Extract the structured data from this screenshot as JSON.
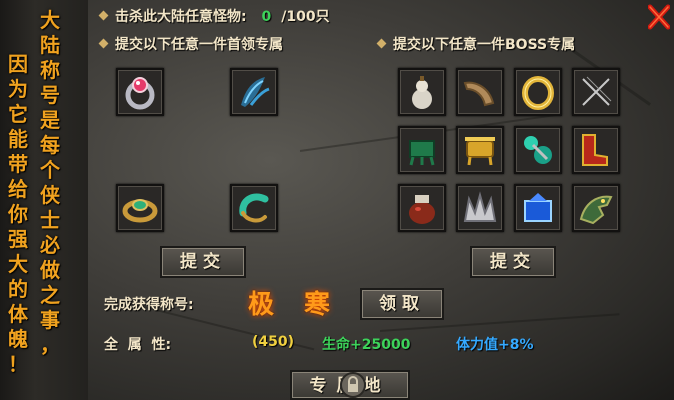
{
  "kill_quest": {
    "label": "击杀此大陆任意怪物:",
    "current": "0",
    "total": "/100只"
  },
  "submit_leader_label": "提交以下任意一件首领专属",
  "submit_boss_label": "提交以下任意一件BOSS专属",
  "scroll": {
    "right_column": [
      "大",
      "陆",
      "称",
      "号",
      "是",
      "每",
      "个",
      "侠",
      "士",
      "必",
      "做",
      "之",
      "事",
      "，"
    ],
    "left_column": [
      "因",
      "为",
      "它",
      "能",
      "带",
      "给",
      "你",
      "强",
      "大",
      "的",
      "体",
      "魄",
      "！"
    ]
  },
  "leader_items": [
    "ruby-ring-icon",
    "blue-feather-icon",
    "jade-ring-icon",
    "jade-bangle-icon"
  ],
  "boss_items": [
    "white-gourd-icon",
    "horn-icon",
    "gold-ring-icon",
    "crossed-needles-icon",
    "jade-tripod-icon",
    "golden-cauldron-icon",
    "jade-pipe-icon",
    "red-boots-icon",
    "red-jar-icon",
    "silver-crown-icon",
    "sapphire-box-icon",
    "dragon-head-icon"
  ],
  "submit_button_left": "提交",
  "submit_button_right": "提交",
  "reward": {
    "label": "完成获得称号:",
    "title_chars": [
      "极",
      "寒"
    ],
    "claim_button": "领取",
    "attr_label": "全  属  性:",
    "attr_value": "(450)",
    "hp_bonus": "生命+25000",
    "stamina_bonus": "体力值+8%"
  },
  "bottom_tab_label": "专属地",
  "colors": {
    "gold": "#f0a21f",
    "green": "#3dd25a",
    "blue": "#35a9ff",
    "yellow": "#f0d040",
    "title": "#ff9a1a"
  }
}
